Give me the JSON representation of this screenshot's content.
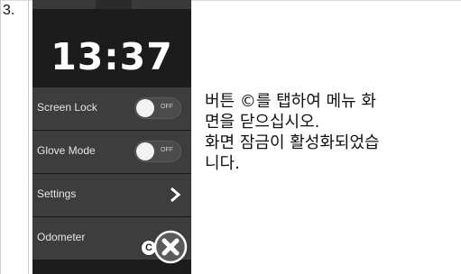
{
  "step": {
    "number": "3."
  },
  "phone": {
    "clock": "13:37",
    "menu_items": [
      {
        "label": "Screen Lock",
        "toggle_state": "OFF"
      },
      {
        "label": "Glove Mode",
        "toggle_state": "OFF"
      },
      {
        "label": "Settings"
      },
      {
        "label": "Odometer"
      }
    ],
    "close_callout": "C"
  },
  "instruction": {
    "line1": "버튼 ©를 탭하여 메뉴 화",
    "line2": "면을 닫으십시오.",
    "line3": "화면 잠금이 활성화되었습",
    "line4": "니다."
  },
  "colors": {
    "phone_bg": "#1c1c1c",
    "row_bg": "#3d3d3d",
    "text": "#111111"
  }
}
